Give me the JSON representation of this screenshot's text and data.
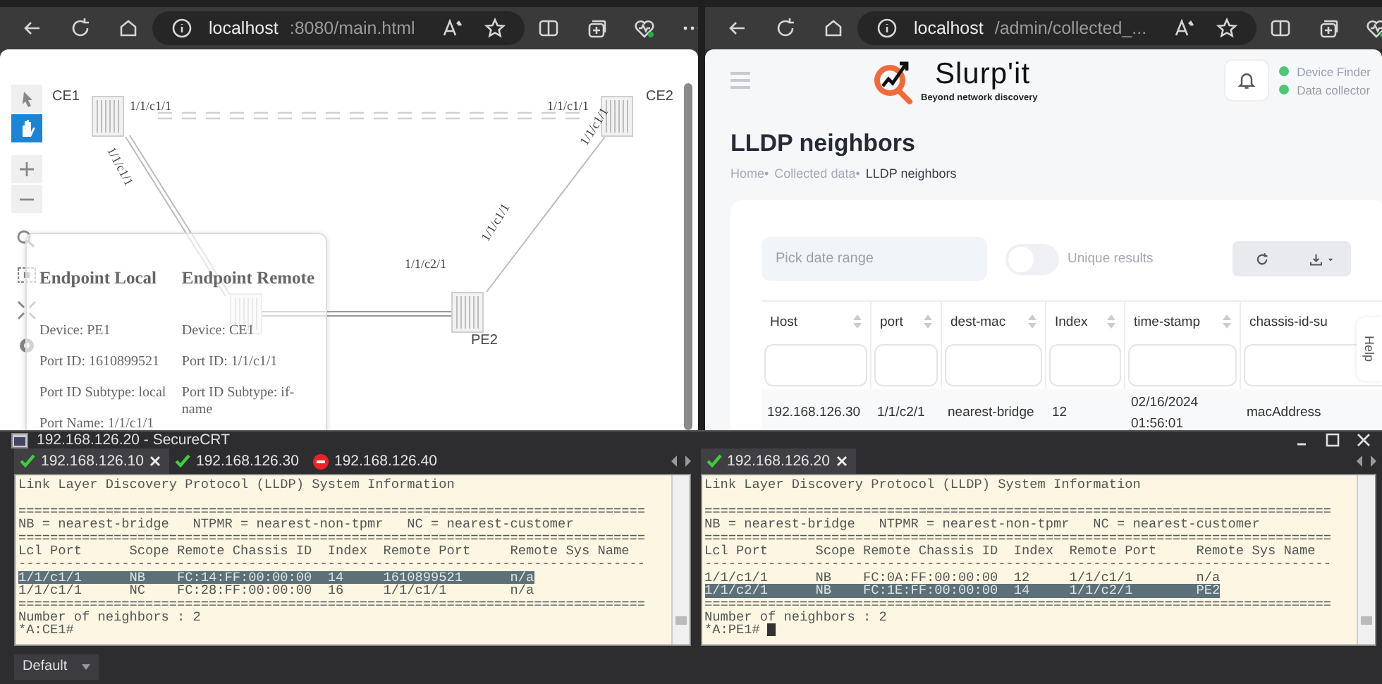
{
  "left_browser": {
    "url_host": "localhost",
    "url_path": ":8080/main.html",
    "tools": [
      {
        "kind": "pointer",
        "selected": false
      },
      {
        "kind": "hand",
        "selected": true
      },
      {
        "kind": "zoom-in",
        "selected": false
      },
      {
        "kind": "zoom-out",
        "selected": false
      },
      {
        "kind": "zoom-select",
        "selected": false
      },
      {
        "kind": "fit",
        "selected": false
      },
      {
        "kind": "expand",
        "selected": false
      },
      {
        "kind": "settings",
        "selected": false
      }
    ],
    "nodes": [
      {
        "name": "CE1"
      },
      {
        "name": "CE2"
      },
      {
        "name": "PE2"
      }
    ],
    "port_labels": [
      {
        "text": "1/1/c1/1",
        "kind": "flat"
      },
      {
        "text": "1/1/c1/1",
        "kind": "flat"
      },
      {
        "text": "1/1/c1/1",
        "kind": "steep"
      },
      {
        "text": "1/1/c1/1",
        "kind": "rising"
      },
      {
        "text": "1/1/c1/1",
        "kind": "rising"
      },
      {
        "text": "1/1/c2/1",
        "kind": "flat"
      }
    ],
    "tooltip": {
      "columns": [
        {
          "heading": "Endpoint Local",
          "fields": [
            "Device: PE1",
            "Port ID: 1610899521",
            "Port ID Subtype: local",
            "Port Name: 1/1/c1/1"
          ]
        },
        {
          "heading": "Endpoint Remote",
          "fields": [
            "Device: CE1",
            "Port ID: 1/1/c1/1",
            "Port ID Subtype: if-name"
          ]
        }
      ]
    }
  },
  "right_browser": {
    "url_host": "localhost",
    "url_path": "/admin/collected_...",
    "logo": {
      "name": "Slurp'it",
      "tagline": "Beyond network discovery"
    },
    "status": [
      {
        "label": "Device Finder"
      },
      {
        "label": "Data collector"
      }
    ],
    "title": "LLDP neighbors",
    "breadcrumb_separator": "•",
    "breadcrumb": [
      {
        "label": "Home",
        "current": false
      },
      {
        "label": "Collected data",
        "current": false
      },
      {
        "label": "LLDP neighbors",
        "current": true
      }
    ],
    "date_field": {
      "placeholder": "Pick date range"
    },
    "toggle": {
      "label": "Unique results",
      "on": false
    },
    "table": {
      "columns": [
        "Host",
        "port",
        "dest-mac",
        "Index",
        "time-stamp",
        "chassis-id-su"
      ],
      "rows": [
        [
          "192.168.126.30",
          "1/1/c2/1",
          "nearest-bridge",
          "12",
          "02/16/2024 01:56:01",
          "macAddress"
        ]
      ]
    },
    "help_tab": "Help"
  },
  "securecrt": {
    "title": "192.168.126.20 - SecureCRT",
    "session": "Default",
    "panes": [
      {
        "cursor": false,
        "tabs": [
          {
            "label": "192.168.126.10",
            "kind": "connected",
            "selected": true
          },
          {
            "label": "192.168.126.30",
            "kind": "connected",
            "selected": false
          },
          {
            "label": "192.168.126.40",
            "kind": "failed",
            "selected": false
          }
        ],
        "lines": [
          {
            "kind": "line",
            "text": "Link Layer Discovery Protocol (LLDP) System Information",
            "selected": false
          },
          {
            "kind": "blank"
          },
          {
            "kind": "line",
            "text": "===============================================================================",
            "selected": false
          },
          {
            "kind": "line",
            "text": "NB = nearest-bridge   NTPMR = nearest-non-tpmr   NC = nearest-customer",
            "selected": false
          },
          {
            "kind": "line",
            "text": "===============================================================================",
            "selected": false
          },
          {
            "kind": "line",
            "text": "Lcl Port      Scope Remote Chassis ID  Index  Remote Port     Remote Sys Name",
            "selected": false
          },
          {
            "kind": "line",
            "text": "-------------------------------------------------------------------------------",
            "selected": false
          },
          {
            "kind": "line",
            "text": "1/1/c1/1      NB    FC:14:FF:00:00:00  14     1610899521      n/a",
            "selected": true
          },
          {
            "kind": "line",
            "text": "1/1/c1/1      NC    FC:28:FF:00:00:00  16     1/1/c1/1        n/a",
            "selected": false
          },
          {
            "kind": "line",
            "text": "===============================================================================",
            "selected": false
          },
          {
            "kind": "line",
            "text": "Number of neighbors : 2",
            "selected": false
          },
          {
            "kind": "line",
            "text": "*A:CE1#",
            "selected": false
          }
        ]
      },
      {
        "cursor": true,
        "tabs": [
          {
            "label": "192.168.126.20",
            "kind": "connected",
            "selected": true
          }
        ],
        "lines": [
          {
            "kind": "line",
            "text": "Link Layer Discovery Protocol (LLDP) System Information",
            "selected": false
          },
          {
            "kind": "blank"
          },
          {
            "kind": "line",
            "text": "===============================================================================",
            "selected": false
          },
          {
            "kind": "line",
            "text": "NB = nearest-bridge   NTPMR = nearest-non-tpmr   NC = nearest-customer",
            "selected": false
          },
          {
            "kind": "line",
            "text": "===============================================================================",
            "selected": false
          },
          {
            "kind": "line",
            "text": "Lcl Port      Scope Remote Chassis ID  Index  Remote Port     Remote Sys Name",
            "selected": false
          },
          {
            "kind": "line",
            "text": "-------------------------------------------------------------------------------",
            "selected": false
          },
          {
            "kind": "line",
            "text": "1/1/c1/1      NB    FC:0A:FF:00:00:00  12     1/1/c1/1        n/a",
            "selected": false
          },
          {
            "kind": "line",
            "text": "1/1/c2/1      NB    FC:1E:FF:00:00:00  14     1/1/c2/1        PE2",
            "selected": true
          },
          {
            "kind": "line",
            "text": "===============================================================================",
            "selected": false
          },
          {
            "kind": "line",
            "text": "Number of neighbors : 2",
            "selected": false
          },
          {
            "kind": "line",
            "text": "*A:PE1#",
            "selected": false
          }
        ]
      }
    ]
  }
}
